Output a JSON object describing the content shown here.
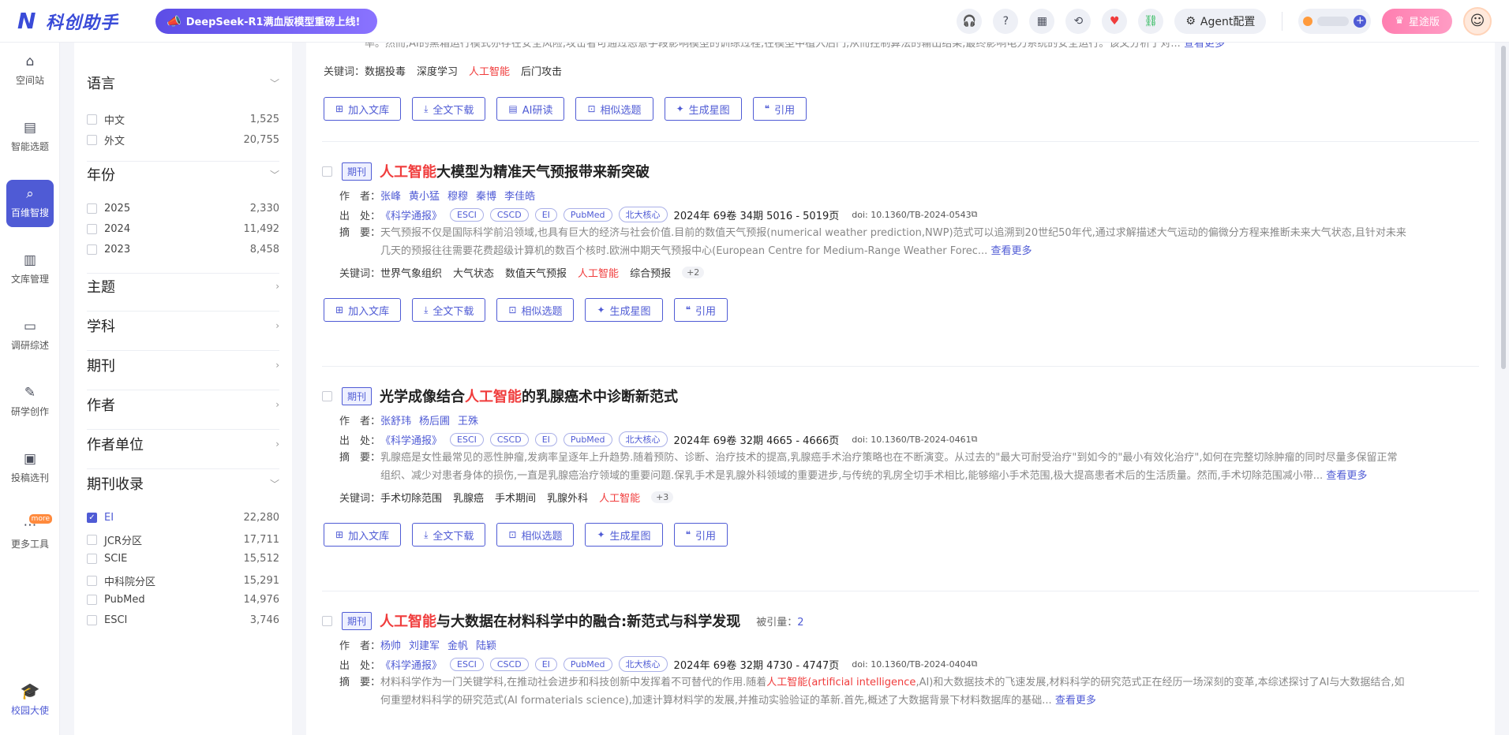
{
  "header": {
    "logo_text": "科创助手",
    "promo_text": "DeepSeek-R1满血版模型重磅上线!",
    "agent_label": "Agent配置",
    "vip_label": "星途版"
  },
  "nav": {
    "items": [
      "空间站",
      "智能选题",
      "百维智搜",
      "文库管理",
      "调研综述",
      "研学创作",
      "投稿选刊",
      "更多工具"
    ],
    "more_badge": "more",
    "ambassador": "校园大使"
  },
  "filters": {
    "language": {
      "title": "语言",
      "options": [
        {
          "label": "中文",
          "count": "1,525"
        },
        {
          "label": "外文",
          "count": "20,755"
        }
      ]
    },
    "year": {
      "title": "年份",
      "options": [
        {
          "label": "2025",
          "count": "2,330"
        },
        {
          "label": "2024",
          "count": "11,492"
        },
        {
          "label": "2023",
          "count": "8,458"
        }
      ]
    },
    "collapsed": [
      "主题",
      "学科",
      "期刊",
      "作者",
      "作者单位"
    ],
    "indexing": {
      "title": "期刊收录",
      "options": [
        {
          "label": "EI",
          "count": "22,280",
          "checked": true
        },
        {
          "label": "JCR分区",
          "count": "17,711"
        },
        {
          "label": "SCIE",
          "count": "15,512"
        },
        {
          "label": "中科院分区",
          "count": "15,291"
        },
        {
          "label": "PubMed",
          "count": "14,976"
        },
        {
          "label": "ESCI",
          "count": "3,746"
        }
      ]
    }
  },
  "labels": {
    "authors": "作　者：",
    "source": "出　处：",
    "abstract": "摘　要：",
    "keywords": "关键词：",
    "journal_tag": "期刊",
    "more": "查看更多",
    "cited": "被引量："
  },
  "actions": [
    "加入文库",
    "全文下载",
    "AI研读",
    "相似选题",
    "生成星图",
    "引用"
  ],
  "top_fragment": {
    "abstract": "率。然而,AI的黑箱运行模式亦存在安全风险,攻击者可通过恶意手段影响模型的训练过程,在模型中植入后门,从而控制算法的输出结果,最终影响电力系统的安全运行。该文分析了对...",
    "keywords": [
      "数据投毒",
      "深度学习",
      "人工智能",
      "后门攻击"
    ]
  },
  "papers": [
    {
      "title_hl": "人工智能",
      "title_rest": "大模型为精准天气预报带来新突破",
      "authors": [
        "张峰",
        "黄小猛",
        "穆穆",
        "秦博",
        "李佳皓"
      ],
      "source": "《科学通报》",
      "tags": [
        "ESCI",
        "CSCD",
        "EI",
        "PubMed",
        "北大核心"
      ],
      "volume": "2024年 69卷 34期 5016 - 5019页",
      "doi": "doi: 10.1360/TB-2024-0543",
      "abstract_1": "天气预报不仅是国际科学前沿领域,也具有巨大的经济与社会价值.目前的数值天气预报(numerical weather prediction,NWP)范式可以追溯到20世纪50年代,通过求解描述大气运动的偏微分方程来推断未来大气状态,且针对未来",
      "abstract_2": "几天的预报往往需要花费超级计算机的数百个核时.欧洲中期天气预报中心(European Centre for Medium-Range Weather Forec...",
      "keywords": [
        "世界气象组织",
        "大气状态",
        "数值天气预报",
        "人工智能",
        "综合预报"
      ],
      "kw_more": "+2"
    },
    {
      "title_pre": "光学成像结合",
      "title_hl": "人工智能",
      "title_rest": "的乳腺癌术中诊断新范式",
      "authors": [
        "张舒玮",
        "杨后圃",
        "王殊"
      ],
      "source": "《科学通报》",
      "tags": [
        "ESCI",
        "CSCD",
        "EI",
        "PubMed",
        "北大核心"
      ],
      "volume": "2024年 69卷 32期 4665 - 4666页",
      "doi": "doi: 10.1360/TB-2024-0461",
      "abstract_1": "乳腺癌是女性最常见的恶性肿瘤,发病率呈逐年上升趋势.随着预防、诊断、治疗技术的提高,乳腺癌手术治疗策略也在不断演变。从过去的\"最大可耐受治疗\"到如今的\"最小有效化治疗\",如何在完整切除肿瘤的同时尽量多保留正常",
      "abstract_2": "组织、减少对患者身体的损伤,一直是乳腺癌治疗领域的重要问题.保乳手术是乳腺外科领域的重要进步,与传统的乳房全切手术相比,能够缩小手术范围,极大提高患者术后的生活质量。然而,手术切除范围减小带...",
      "keywords": [
        "手术切除范围",
        "乳腺癌",
        "手术期间",
        "乳腺外科",
        "人工智能"
      ],
      "kw_more": "+3"
    },
    {
      "title_hl": "人工智能",
      "title_rest": "与大数据在材料科学中的融合:新范式与科学发现",
      "cited": "2",
      "authors": [
        "杨帅",
        "刘建军",
        "金帆",
        "陆颖"
      ],
      "source": "《科学通报》",
      "tags": [
        "ESCI",
        "CSCD",
        "EI",
        "PubMed",
        "北大核心"
      ],
      "volume": "2024年 69卷 32期 4730 - 4747页",
      "doi": "doi: 10.1360/TB-2024-0404",
      "abstract_1a": "材料科学作为一门关键学科,在推动社会进步和科技创新中发挥着不可替代的作用.随着",
      "abstract_1hl": "人工智能(artificial intelligence",
      "abstract_1b": ",AI)和大数据技术的飞速发展,材料科学的研究范式正在经历一场深刻的变革,本综述探讨了AI与大数据结合,如",
      "abstract_2": "何重塑材料科学的研究范式(AI formaterials science),加速计算材料学的发展,并推动实验验证的革新.首先,概述了大数据背景下材料数据库的基础..."
    }
  ]
}
